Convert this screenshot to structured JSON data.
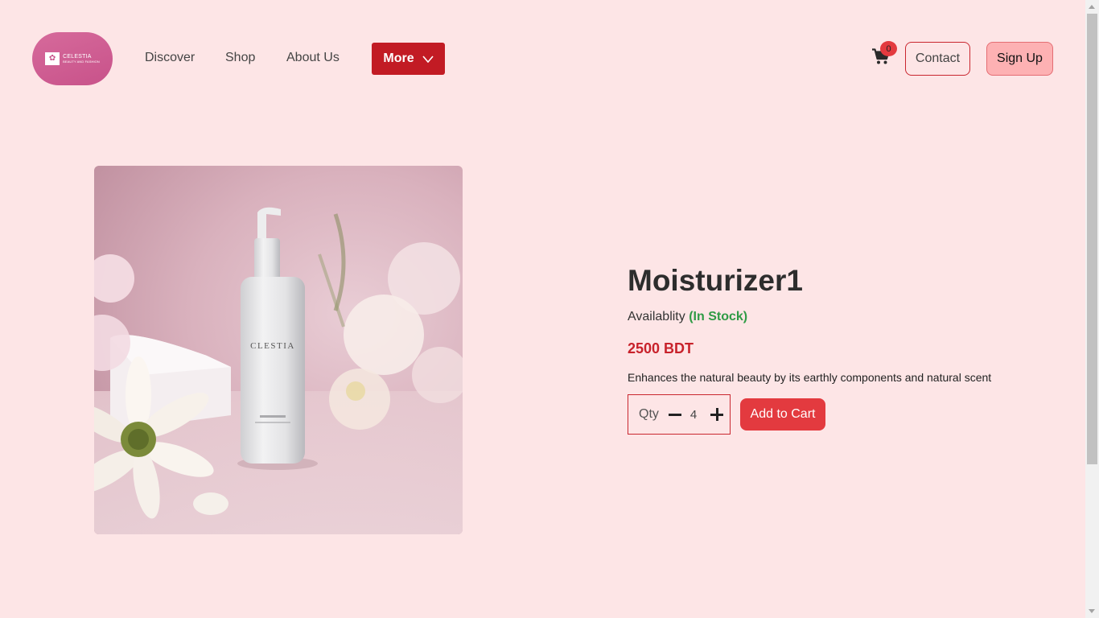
{
  "header": {
    "logo": {
      "name": "CELESTIA",
      "tagline": "BEAUTY AND FASHION"
    },
    "nav": [
      {
        "label": "Discover"
      },
      {
        "label": "Shop"
      },
      {
        "label": "About Us"
      }
    ],
    "more_label": "More",
    "cart_count": "0",
    "contact_label": "Contact",
    "signup_label": "Sign Up"
  },
  "product": {
    "bottle_brand": "CLESTIA",
    "title": "Moisturizer1",
    "availability_label": "Availablity",
    "availability_status": "(In Stock)",
    "price": "2500 BDT",
    "description": "Enhances the natural beauty by its earthly components and natural scent",
    "qty_label": "Qty",
    "qty_value": "4",
    "add_to_cart_label": "Add to Cart"
  },
  "colors": {
    "background": "#fde5e6",
    "accent": "#c21b24",
    "button": "#e33a3f",
    "in_stock": "#2f9b45",
    "price": "#c8222b"
  },
  "icons": [
    "cart-icon",
    "chevron-down-icon",
    "minus-icon",
    "plus-icon"
  ]
}
